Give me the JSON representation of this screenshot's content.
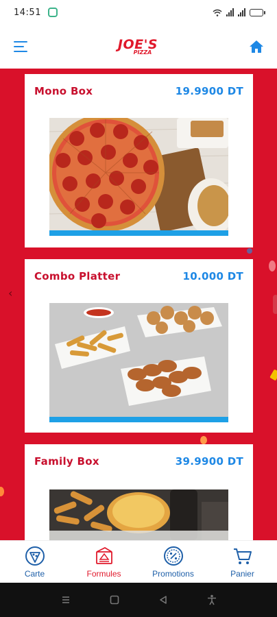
{
  "status_bar": {
    "time": "14:51"
  },
  "header": {
    "logo_main": "JOE'S",
    "logo_sub": "PIZZA"
  },
  "products": [
    {
      "name": "Mono Box",
      "price": "19.9900 DT"
    },
    {
      "name": "Combo Platter",
      "price": "10.000 DT"
    },
    {
      "name": "Family Box",
      "price": "39.9900 DT"
    }
  ],
  "bottom_nav": [
    {
      "label": "Carte",
      "icon": "pizza-slice-icon",
      "active": false
    },
    {
      "label": "Formules",
      "icon": "pizza-box-icon",
      "active": true
    },
    {
      "label": "Promotions",
      "icon": "percent-badge-icon",
      "active": false
    },
    {
      "label": "Panier",
      "icon": "cart-icon",
      "active": false
    }
  ],
  "colors": {
    "brand_red": "#d9112a",
    "accent_blue": "#1e88e5",
    "title_red": "#c8102e"
  }
}
